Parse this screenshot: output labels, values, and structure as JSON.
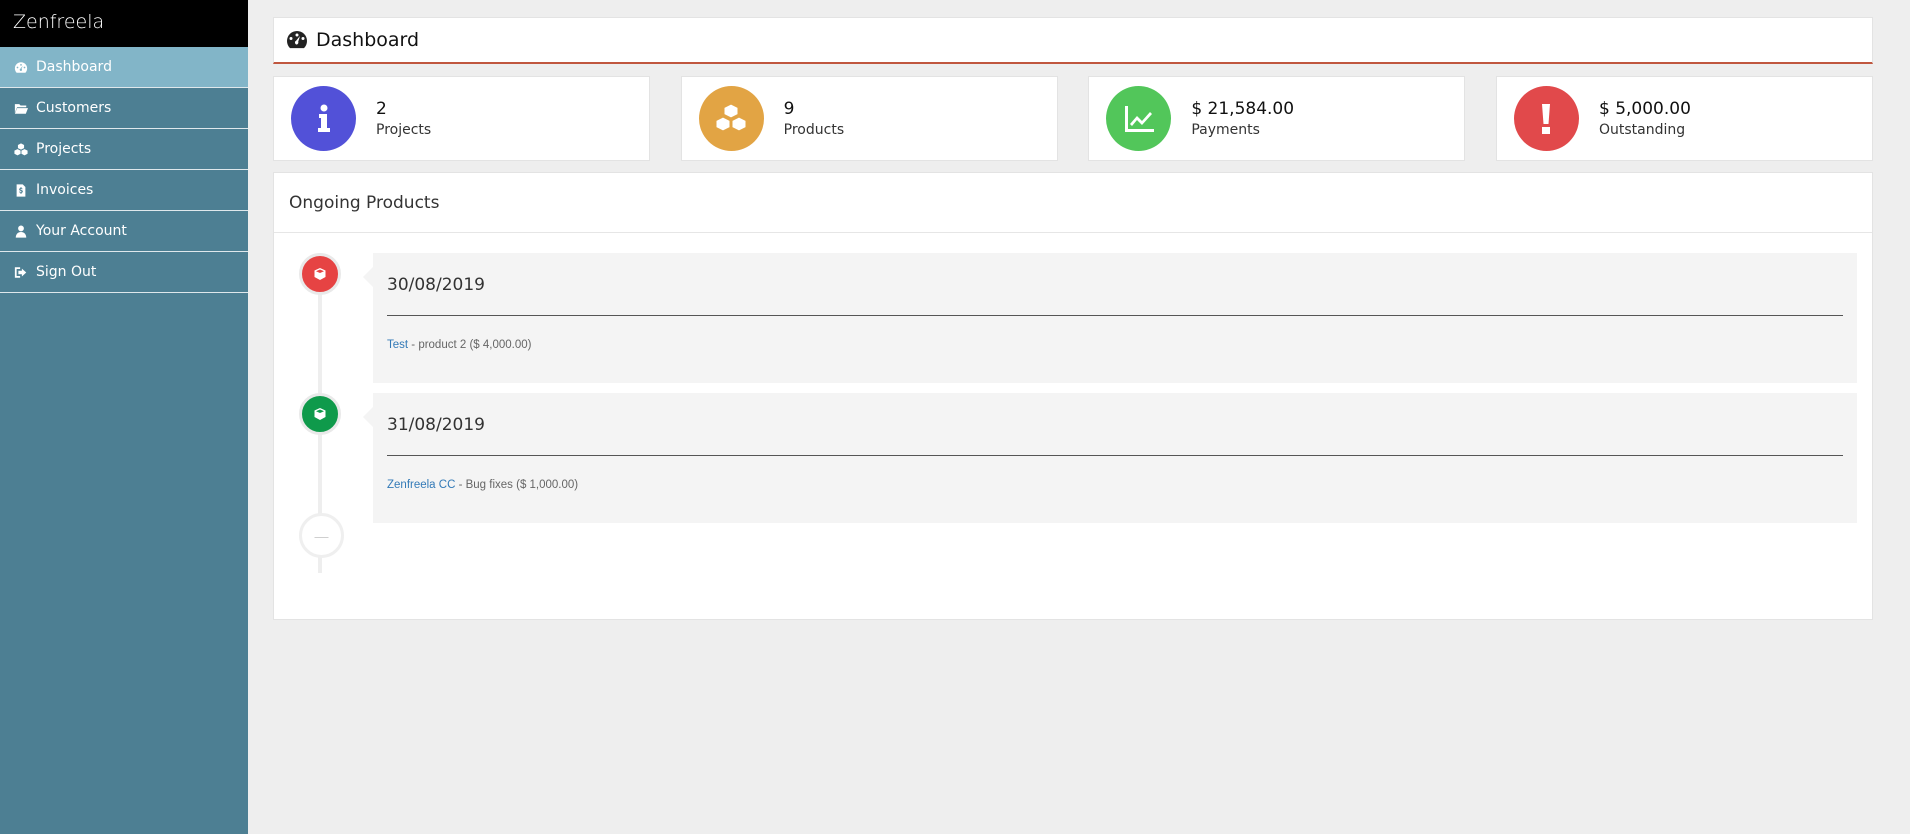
{
  "brand": "Zenfreela",
  "sidebar": {
    "items": [
      {
        "label": "Dashboard",
        "icon": "dashboard-icon"
      },
      {
        "label": "Customers",
        "icon": "folder-icon"
      },
      {
        "label": "Projects",
        "icon": "cubes-icon"
      },
      {
        "label": "Invoices",
        "icon": "invoice-icon"
      },
      {
        "label": "Your Account",
        "icon": "user-icon"
      },
      {
        "label": "Sign Out",
        "icon": "sign-out-icon"
      }
    ],
    "active": "Dashboard"
  },
  "header": {
    "title": "Dashboard",
    "icon": "dashboard-icon"
  },
  "stats": [
    {
      "value": "2",
      "label": "Projects",
      "icon": "info-icon",
      "color": "#5251d8"
    },
    {
      "value": "9",
      "label": "Products",
      "icon": "cubes-icon",
      "color": "#e2a444"
    },
    {
      "value": "$ 21,584.00",
      "label": "Payments",
      "icon": "line-chart-icon",
      "color": "#52c65a"
    },
    {
      "value": "$ 5,000.00",
      "label": "Outstanding",
      "icon": "exclamation-icon",
      "color": "#e1494b"
    }
  ],
  "ongoing": {
    "title": "Ongoing Products",
    "items": [
      {
        "date": "30/08/2019",
        "link": "Test",
        "detail": " - product 2 ($ 4,000.00)",
        "dot_color": "#e64343",
        "icon": "cube-icon"
      },
      {
        "date": "31/08/2019",
        "link": "Zenfreela CC",
        "detail": " - Bug fixes ($ 1,000.00)",
        "dot_color": "#0f9a4b",
        "icon": "cube-icon"
      }
    ],
    "end_marker": "—"
  }
}
